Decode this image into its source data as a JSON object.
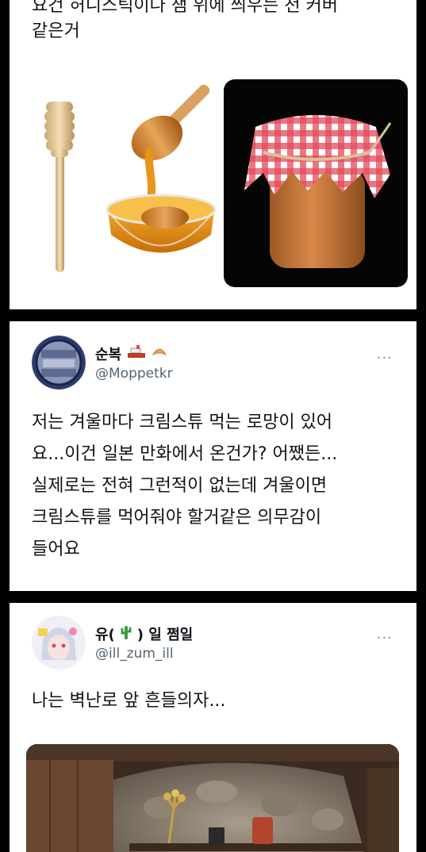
{
  "tweet1": {
    "text": "요건 허니스틱이나 잼 위에 씌우는 천 커버\n같은거"
  },
  "tweet2": {
    "name": "순복",
    "handle": "@Moppetkr",
    "more": "···",
    "text": "저는 겨울마다 크림스튜 먹는 로망이 있어\n요...이건 일본 만화에서 온건가? 어쨌든...\n실제로는 전혀 그런적이 없는데 겨울이면\n크림스튜를 먹어줘야 할거같은 의무감이\n들어요"
  },
  "tweet3": {
    "name_prefix": "유(",
    "name_suffix": ") 일 쩜일",
    "handle": "@ill_zum_ill",
    "more": "···",
    "text": "나는 벽난로 앞 흔들의자..."
  },
  "colors": {
    "page_bg": "#000000",
    "card_bg": "#ffffff",
    "secondary_text": "#536471",
    "honey": "#e59b1a"
  }
}
